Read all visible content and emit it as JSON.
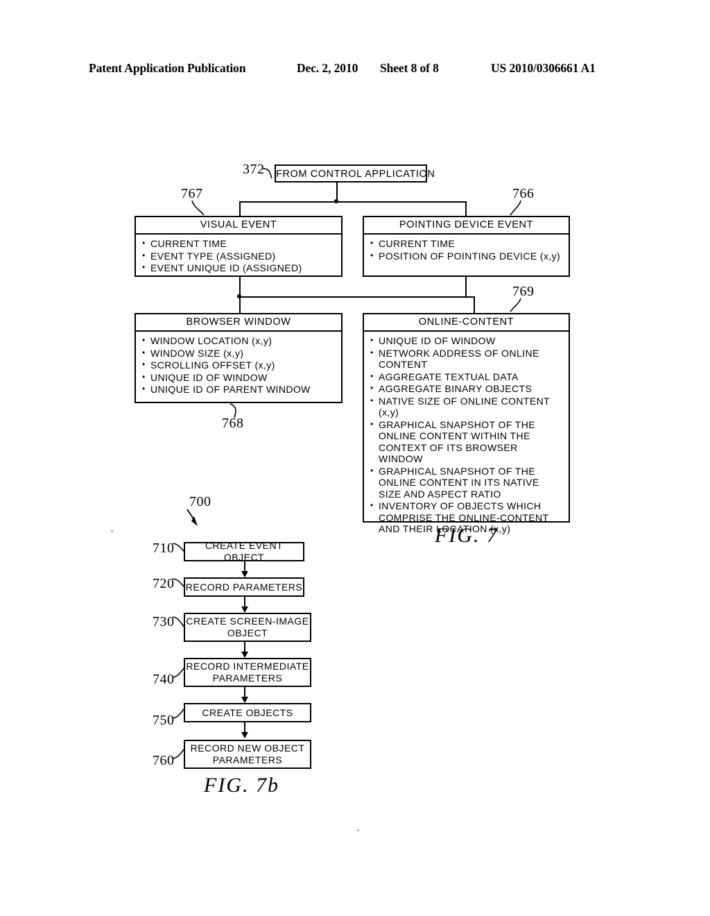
{
  "header": {
    "publication": "Patent Application Publication",
    "date": "Dec. 2, 2010",
    "sheet": "Sheet 8 of 8",
    "patent_number": "US 2010/0306661 A1"
  },
  "fig7": {
    "caption": "FIG. 7",
    "source_box": {
      "ref": "372",
      "label": "FROM CONTROL APPLICATION"
    },
    "boxes": [
      {
        "ref": "767",
        "title": "VISUAL EVENT",
        "items": [
          "CURRENT TIME",
          "EVENT TYPE (ASSIGNED)",
          "EVENT UNIQUE ID (ASSIGNED)"
        ]
      },
      {
        "ref": "766",
        "title": "POINTING DEVICE EVENT",
        "items": [
          "CURRENT TIME",
          "POSITION OF POINTING DEVICE (x,y)"
        ]
      },
      {
        "ref": "768",
        "title": "BROWSER WINDOW",
        "items": [
          "WINDOW LOCATION (x,y)",
          "WINDOW SIZE (x,y)",
          "SCROLLING OFFSET (x,y)",
          "UNIQUE ID OF WINDOW",
          "UNIQUE ID OF PARENT WINDOW"
        ]
      },
      {
        "ref": "769",
        "title": "ONLINE-CONTENT",
        "items": [
          "UNIQUE ID OF WINDOW",
          "NETWORK ADDRESS OF ONLINE CONTENT",
          "AGGREGATE TEXTUAL DATA",
          "AGGREGATE BINARY OBJECTS",
          "NATIVE SIZE OF ONLINE CONTENT (x,y)",
          "GRAPHICAL SNAPSHOT OF THE ONLINE CONTENT WITHIN THE CONTEXT OF ITS BROWSER WINDOW",
          "GRAPHICAL SNAPSHOT OF THE ONLINE CONTENT IN ITS NATIVE SIZE AND ASPECT RATIO",
          "INVENTORY OF OBJECTS WHICH COMPRISE THE ONLINE-CONTENT AND THEIR LOCATION (x,y)"
        ]
      }
    ]
  },
  "fig7b": {
    "caption": "FIG. 7b",
    "flow_ref": "700",
    "steps": [
      {
        "ref": "710",
        "label": "CREATE EVENT OBJECT"
      },
      {
        "ref": "720",
        "label": "RECORD PARAMETERS"
      },
      {
        "ref": "730",
        "label": "CREATE SCREEN-IMAGE OBJECT"
      },
      {
        "ref": "740",
        "label": "RECORD INTERMEDIATE PARAMETERS"
      },
      {
        "ref": "750",
        "label": "CREATE OBJECTS"
      },
      {
        "ref": "760",
        "label": "RECORD NEW OBJECT PARAMETERS"
      }
    ]
  }
}
